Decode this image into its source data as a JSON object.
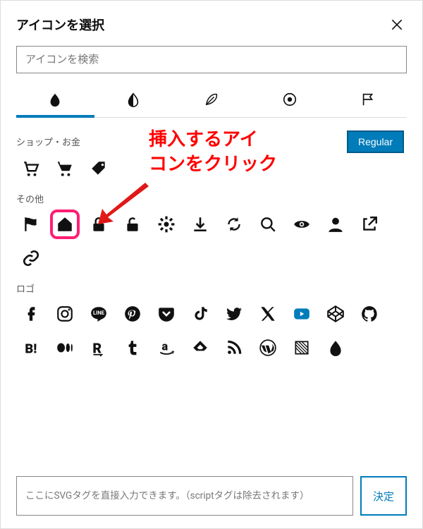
{
  "dialog": {
    "title": "アイコンを選択",
    "close_aria": "閉じる"
  },
  "search": {
    "placeholder": "アイコンを検索"
  },
  "style_tabs": [
    {
      "name": "solid",
      "active": true
    },
    {
      "name": "half",
      "active": false
    },
    {
      "name": "outline",
      "active": false
    },
    {
      "name": "target",
      "active": false
    },
    {
      "name": "flag",
      "active": false
    }
  ],
  "weight_button": "Regular",
  "sections": {
    "shop": {
      "label": "ショップ・お金",
      "icons": [
        "cart-icon",
        "cart-solid-icon",
        "tag-icon"
      ]
    },
    "other": {
      "label": "その他",
      "icons_row1": [
        "flag-icon",
        "home-icon",
        "lock-icon",
        "unlock-icon",
        "gear-icon",
        "download-icon",
        "refresh-icon",
        "search-icon",
        "eye-icon",
        "user-icon"
      ],
      "icons_row2": [
        "external-link-icon",
        "link-icon"
      ],
      "highlighted": "home-icon"
    },
    "logo": {
      "label": "ロゴ",
      "icons_row1": [
        "facebook-icon",
        "instagram-icon",
        "line-icon",
        "pinterest-icon",
        "pocket-icon",
        "tiktok-icon",
        "twitter-bird-icon",
        "x-icon",
        "youtube-icon",
        "codepen-icon"
      ],
      "icons_row2": [
        "github-icon",
        "hatena-icon",
        "medium-icon",
        "rakuten-icon",
        "tumblr-icon",
        "amazon-icon",
        "feedly-icon",
        "rss-icon",
        "wordpress-icon",
        "stack-icon"
      ],
      "icons_row3": [
        "swell-icon"
      ]
    }
  },
  "annotation": {
    "line1": "挿入するアイ",
    "line2": "コンをクリック"
  },
  "footer": {
    "svg_placeholder": "ここにSVGタグを直接入力できます。（scriptタグは除去されます）",
    "confirm_label": "決定"
  },
  "colors": {
    "accent": "#007cba",
    "annotation": "#ff0000",
    "highlight": "#ff1e73"
  }
}
